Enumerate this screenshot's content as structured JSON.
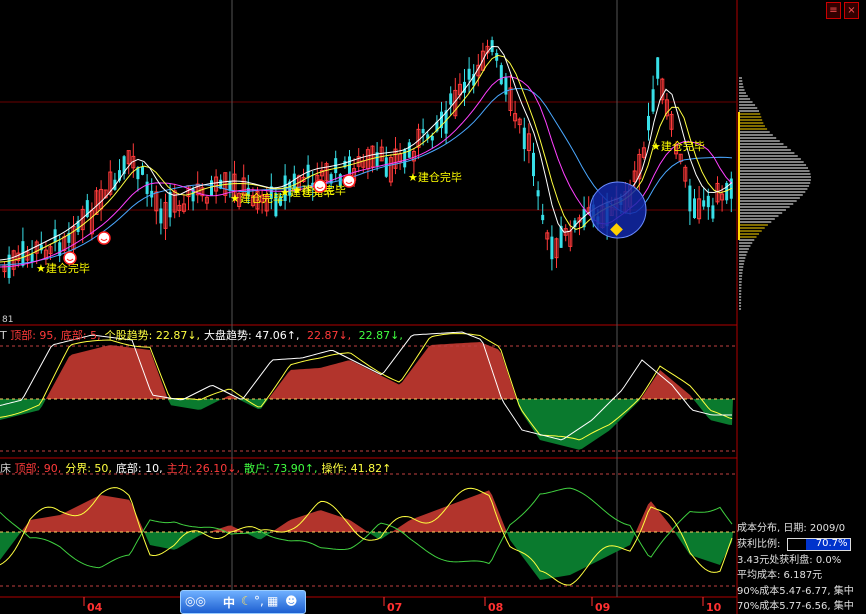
{
  "colors": {
    "background": "#000000",
    "frame": "#b00000",
    "candle_up": "#ff3a3a",
    "candle_down": "#38e0e8",
    "ma_white": "#ffffff",
    "ma_yellow": "#ffff40",
    "ma_magenta": "#ff40ff",
    "ma_blue": "#4aa8ff",
    "fill_red": "#b2342c",
    "fill_green": "#0a7a2e",
    "signal_yellow": "#ffff00",
    "axis_label": "#ff3030",
    "cost_bar": "#ffffff",
    "cost_bar_gold": "#ffd700"
  },
  "top_right_icons": [
    "document-icon",
    "close-icon"
  ],
  "main_panel": {
    "corner_label": "81",
    "signal_label": "★建仓完毕",
    "smile_icon": "smiley-icon",
    "warning_icon": "diamond-warning-icon"
  },
  "indicator1": {
    "prefix": "T",
    "items": [
      {
        "label": "顶部:",
        "value": "95,",
        "color": "#ff3a3a"
      },
      {
        "label": "底部:",
        "value": "5,",
        "color": "#ff3a3a"
      },
      {
        "label": "个股趋势:",
        "value": "22.87",
        "arrow": "↓,",
        "color": "#ffff40"
      },
      {
        "label": "大盘趋势:",
        "value": "47.06",
        "arrow": "↑,",
        "color": "#ffffff"
      },
      {
        "label": "",
        "value": "22.87",
        "arrow": "↓,",
        "color": "#ff3a3a"
      },
      {
        "label": "",
        "value": "22.87",
        "arrow": "↓,",
        "color": "#40ff40"
      }
    ]
  },
  "indicator2": {
    "prefix": "床",
    "items": [
      {
        "label": "顶部:",
        "value": "90,",
        "color": "#ff3a3a"
      },
      {
        "label": "分界:",
        "value": "50,",
        "color": "#ffff40"
      },
      {
        "label": "底部:",
        "value": "10,",
        "color": "#ffffff"
      },
      {
        "label": "主力:",
        "value": "26.10",
        "arrow": "↓,",
        "color": "#ff3a3a"
      },
      {
        "label": "散户:",
        "value": "73.90",
        "arrow": "↑,",
        "color": "#40ff40"
      },
      {
        "label": "操作:",
        "value": "41.82",
        "arrow": "↑",
        "color": "#ffff40"
      }
    ]
  },
  "x_axis_months": [
    "04",
    "07",
    "08",
    "09",
    "10"
  ],
  "taskbar_icons": [
    "olympic-rings-icon",
    "chinese-input-icon",
    "moon-icon",
    "punctuation-icon",
    "keyboard-icon",
    "user-icon"
  ],
  "taskbar_labels": {
    "ime": "中"
  },
  "cost_panel": {
    "title": "成本分布, 日期: 2009/0",
    "profit_label": "获利比例:",
    "profit_value": "70.7%",
    "profit_ratio": 0.707,
    "line1": "3.43元处获利盘: 0.0%",
    "line2": "平均成本: 6.187元",
    "line3": "90%成本5.47-6.77, 集中",
    "line4": "70%成本5.77-6.56, 集中"
  },
  "chart_data": [
    {
      "type": "candlestick",
      "name": "price",
      "x_ticks": [
        "04",
        "07",
        "08",
        "09",
        "10"
      ],
      "markers": [
        "★建仓完毕",
        "★建仓完毕",
        "★建仓完毕",
        "★建仓完毕",
        "★建仓完毕",
        "★建仓完毕"
      ]
    },
    {
      "type": "area",
      "levels": {
        "top": 95,
        "bottom": 5
      },
      "series": [
        {
          "name": "个股趋势",
          "last": 22.87
        },
        {
          "name": "大盘趋势",
          "last": 47.06
        }
      ]
    },
    {
      "type": "area",
      "levels": {
        "top": 90,
        "divider": 50,
        "bottom": 10
      },
      "series": [
        {
          "name": "主力",
          "last": 26.1
        },
        {
          "name": "散户",
          "last": 73.9
        },
        {
          "name": "操作",
          "last": 41.82
        }
      ]
    }
  ]
}
